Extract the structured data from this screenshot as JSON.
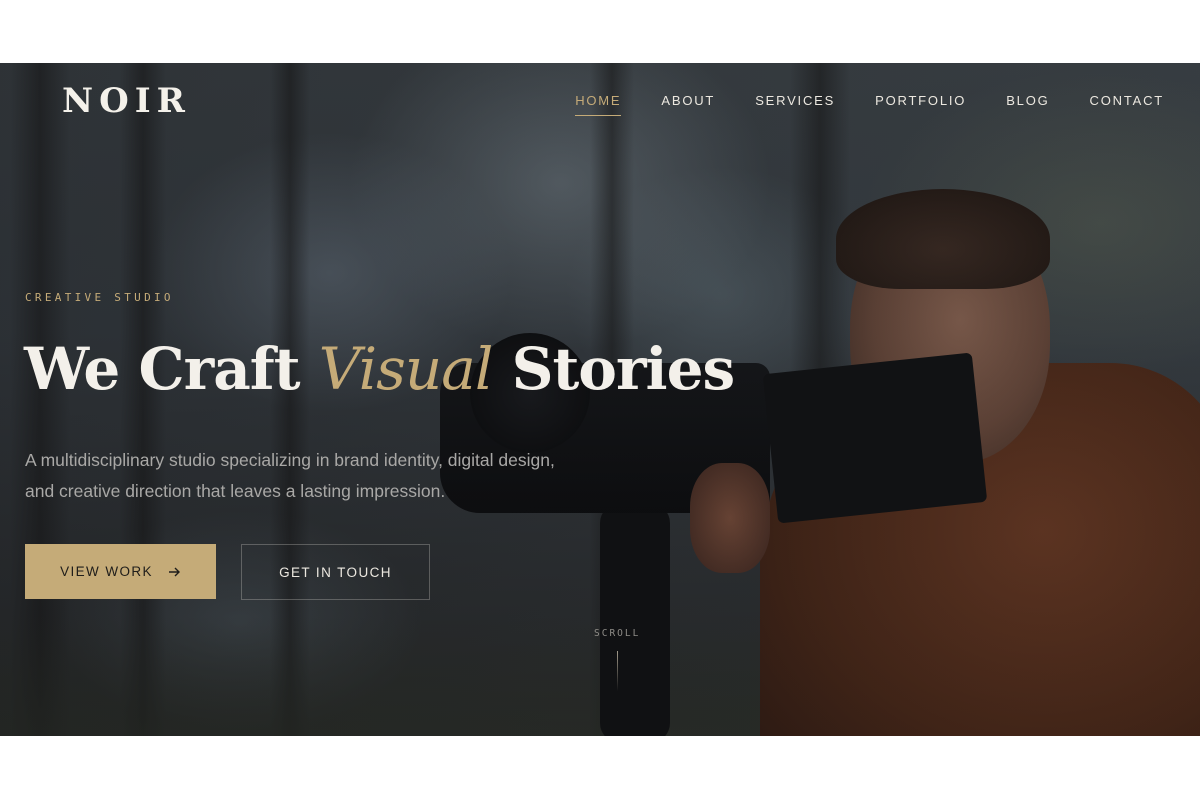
{
  "brand": {
    "logo_text": "NOIR"
  },
  "nav": {
    "items": [
      {
        "label": "HOME",
        "active": true
      },
      {
        "label": "ABOUT",
        "active": false
      },
      {
        "label": "SERVICES",
        "active": false
      },
      {
        "label": "PORTFOLIO",
        "active": false
      },
      {
        "label": "BLOG",
        "active": false
      },
      {
        "label": "CONTACT",
        "active": false
      }
    ]
  },
  "hero": {
    "eyebrow": "CREATIVE STUDIO",
    "headline_before": "We Craft ",
    "headline_accent": "Visual",
    "headline_after": " Stories",
    "subtext": "A multidisciplinary studio specializing in brand identity, digital design, and creative direction that leaves a lasting impression.",
    "primary_button": "VIEW WORK",
    "primary_button_icon": "arrow-right-icon",
    "secondary_button": "GET IN TOUCH",
    "scroll_label": "SCROLL"
  },
  "colors": {
    "accent": "#c5ab78",
    "text_light": "#f3f0ea",
    "text_muted": "#a9a8a6"
  }
}
